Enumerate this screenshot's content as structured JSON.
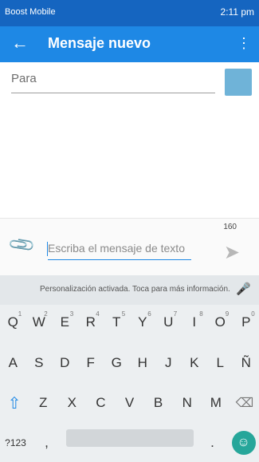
{
  "status_bar": {
    "carrier": "Boost Mobile",
    "time": "2:11 pm"
  },
  "app_bar": {
    "title": "Mensaje nuevo"
  },
  "recipient": {
    "label": "Para"
  },
  "compose": {
    "char_count": "160",
    "placeholder": "Escriba el mensaje de texto"
  },
  "keyboard": {
    "suggestion": "Personalización activada. Toca para más información.",
    "row1": [
      {
        "key": "Q",
        "alt": "1"
      },
      {
        "key": "W",
        "alt": "2"
      },
      {
        "key": "E",
        "alt": "3"
      },
      {
        "key": "R",
        "alt": "4"
      },
      {
        "key": "T",
        "alt": "5"
      },
      {
        "key": "Y",
        "alt": "6"
      },
      {
        "key": "U",
        "alt": "7"
      },
      {
        "key": "I",
        "alt": "8"
      },
      {
        "key": "O",
        "alt": "9"
      },
      {
        "key": "P",
        "alt": "0"
      }
    ],
    "row2": [
      "A",
      "S",
      "D",
      "F",
      "G",
      "H",
      "J",
      "K",
      "L",
      "Ñ"
    ],
    "row3": [
      "Z",
      "X",
      "C",
      "V",
      "B",
      "N",
      "M"
    ],
    "symbols_label": "?123",
    "comma": ",",
    "period": "."
  }
}
